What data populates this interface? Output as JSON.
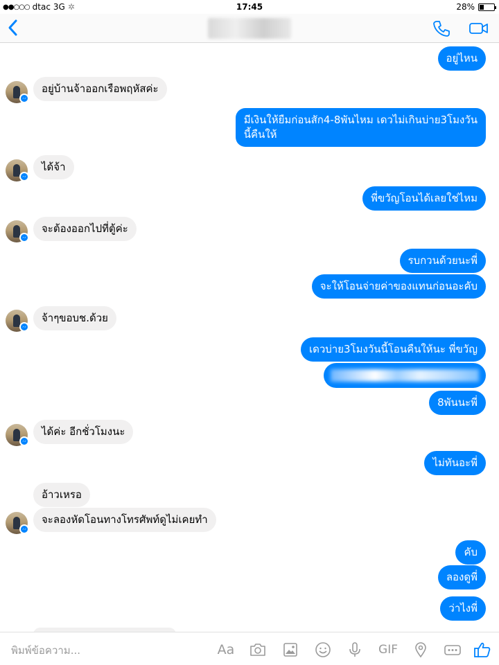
{
  "status_bar": {
    "carrier": "dtac",
    "network": "3G",
    "time": "17:45",
    "battery": "28%",
    "battery_level": 0.28
  },
  "nav": {
    "back_icon": "chevron-left-icon",
    "contact_name_blurred": true,
    "call_icon": "phone-icon",
    "video_icon": "video-camera-icon"
  },
  "accent_color": "#0084ff",
  "messages": [
    {
      "dir": "out",
      "text": "อยู่ไหน"
    },
    {
      "dir": "in",
      "text": "อยู่บ้านจ้าออกเรือพฤหัสค่ะ"
    },
    {
      "dir": "out",
      "text": "มีเงินให้ยืมก่อนสัก4-8พันไหม เดวไม่เกินบ่าย3โมงวัน",
      "text2": "นี้คืนให้"
    },
    {
      "dir": "in",
      "text": "ได้จ้า"
    },
    {
      "dir": "out",
      "text": "พี่ขวัญโอนได้เลยใช่ไหม"
    },
    {
      "dir": "in",
      "text": "จะต้องออกไปที่ตู้ค่ะ"
    },
    {
      "dir": "out",
      "text": "รบกวนด้วยนะพี่"
    },
    {
      "dir": "out",
      "text": "จะให้โอนจ่ายค่าของแทนก่อนอะคับ"
    },
    {
      "dir": "in",
      "text": "จ้าๆขอบช.ด้วย"
    },
    {
      "dir": "out",
      "text": "เดวบ่าย3โมงวันนี้โอนคืนให้นะ พี่ขวัญ"
    },
    {
      "dir": "out",
      "text": "",
      "blurred": true
    },
    {
      "dir": "out",
      "text": "8พันนะพี่"
    },
    {
      "dir": "in",
      "text": "ได้ค่ะ อีกชั่วโมงนะ"
    },
    {
      "dir": "out",
      "text": "ไม่ทันอะพี่"
    },
    {
      "dir": "in",
      "text": "อ้าวเหรอ"
    },
    {
      "dir": "in",
      "text": "จะลองหัดโอนทางโทรศัพท์ดูไม่เคยทำ"
    },
    {
      "dir": "out",
      "text": "คับ"
    },
    {
      "dir": "out",
      "text": "ลองดูพี่"
    },
    {
      "dir": "out",
      "text": "ว่าไงพี่"
    }
  ],
  "composer": {
    "placeholder": "พิมพ์ข้อความ...",
    "text_format_label": "Aa",
    "gif_label": "GIF",
    "tools": [
      "text-format-icon",
      "camera-icon",
      "photo-icon",
      "emoji-icon",
      "microphone-icon",
      "gif-icon",
      "location-icon",
      "more-icon",
      "thumbs-up-icon"
    ]
  }
}
